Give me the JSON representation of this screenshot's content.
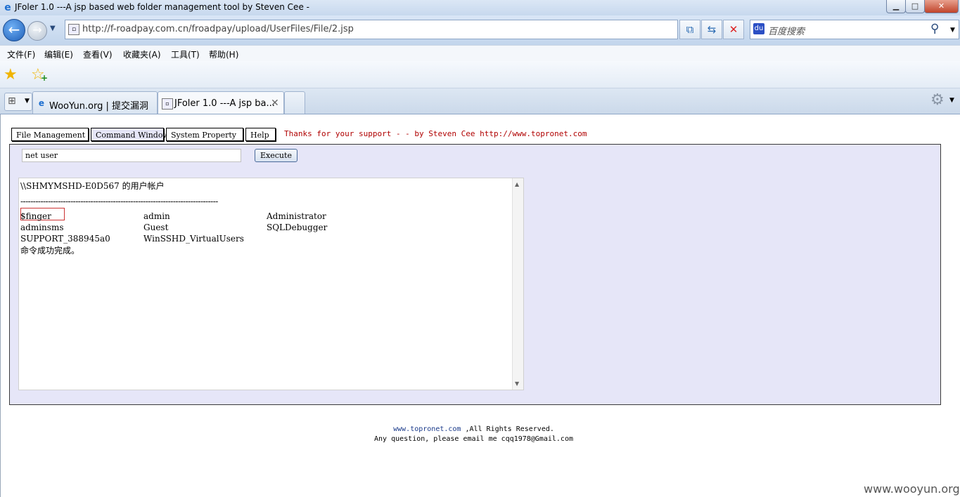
{
  "window": {
    "title": "JFoler 1.0 ---A jsp based web folder management tool by Steven Cee -",
    "min_label": "▁",
    "max_label": "□",
    "close_label": "✕"
  },
  "nav": {
    "url": "http://f-roadpay.com.cn/froadpay/upload/UserFiles/File/2.jsp",
    "search_placeholder": "百度搜索",
    "back_icon": "back-arrow-icon",
    "forward_icon": "forward-arrow-icon"
  },
  "menu": [
    "文件(F)",
    "编辑(E)",
    "查看(V)",
    "收藏夹(A)",
    "工具(T)",
    "帮助(H)"
  ],
  "tabs": [
    {
      "label": "WooYun.org | 提交漏洞"
    },
    {
      "label": "JFoler 1.0 ---A jsp ba..."
    }
  ],
  "page": {
    "tabs": [
      "File Management",
      "Command Window",
      "System Property",
      "Help"
    ],
    "active_tab": "Command Window",
    "thanks": "Thanks for your support - - by Steven Cee http://www.topronet.com",
    "command_value": "net user",
    "execute_label": "Execute",
    "output": {
      "header": "\\\\SHMYMSHD-E0D567 的用户帐户",
      "separator": "-------------------------------------------------------------------------------",
      "rows": [
        [
          "$finger",
          "admin",
          "Administrator"
        ],
        [
          "adminsms",
          "Guest",
          "SQLDebugger"
        ],
        [
          "SUPPORT_388945a0",
          "WinSSHD_VirtualUsers",
          ""
        ]
      ],
      "done": "命令成功完成。"
    },
    "footer_link": "www.topronet.com",
    "footer_rights": " ,All Rights Reserved.",
    "footer_contact": "Any question, please email me cqq1978@Gmail.com"
  },
  "watermark": "www.wooyun.org",
  "colors": {
    "panel_bg": "#e6e6f8",
    "thanks_text": "#b00000",
    "highlight_border": "#cc3333"
  }
}
